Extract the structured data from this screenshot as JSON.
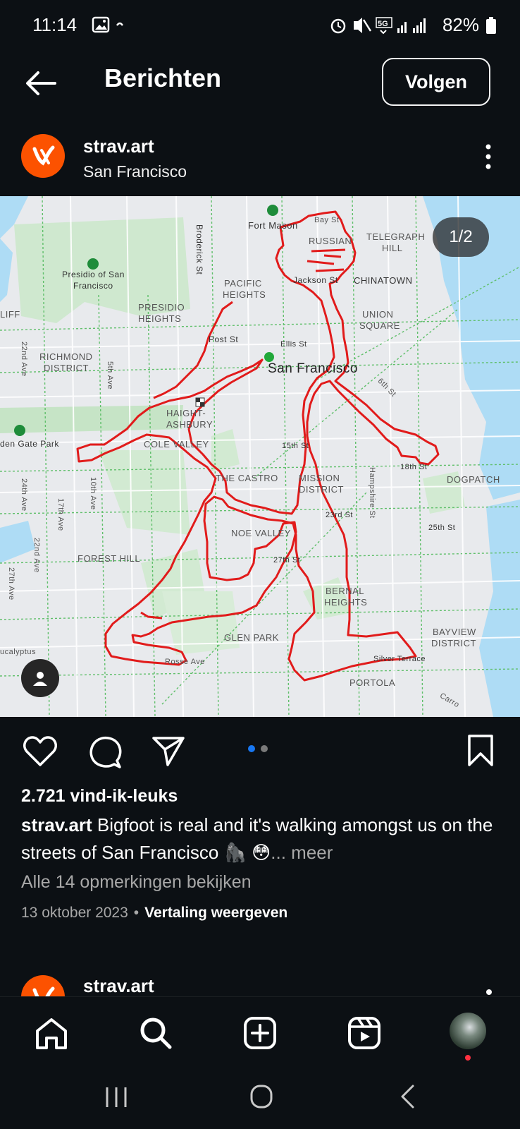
{
  "status": {
    "time": "11:14",
    "network": "5G",
    "battery": "82%"
  },
  "header": {
    "title": "Berichten",
    "follow_label": "Volgen"
  },
  "post": {
    "account": "strav.art",
    "location": "San Francisco",
    "counter": "1/2",
    "likes": "2.721 vind-ik-leuks",
    "caption_user": "strav.art",
    "caption_text": "Bigfoot is real and it's walking amongst us on the streets of San Francisco 🦍 😳",
    "caption_more": "... meer",
    "comments_link": "Alle 14 opmerkingen bekijken",
    "date": "13 oktober 2023",
    "separator": "•",
    "translate": "Vertaling weergeven"
  },
  "next_post": {
    "account": "strav.art"
  },
  "map": {
    "labels": {
      "fort_mason": "Fort Mason",
      "bay_st": "Bay St",
      "russian_hill": "RUSSIAN",
      "telegraph": "TELEGRAPH",
      "hill": "HILL",
      "chinatown": "CHINATOWN",
      "jackson_st": "Jackson St",
      "presidio": "Presidio of San",
      "francisco": "Francisco",
      "pacific": "PACIFIC",
      "heights": "HEIGHTS",
      "presidio_h": "PRESIDIO",
      "presidio_h2": "HEIGHTS",
      "broderick": "Broderick St",
      "union": "UNION",
      "square": "SQUARE",
      "post_st": "Post St",
      "ellis_st": "Ellis St",
      "san_francisco": "San Francisco",
      "richmond": "RICHMOND",
      "district": "DISTRICT",
      "ave22": "22nd Ave",
      "ave5": "5th Ave",
      "sixth": "6th St",
      "haight": "HAIGHT-",
      "ashbury": "ASHBURY",
      "cole": "COLE VALLEY",
      "golden": "den Gate Park",
      "fifteenth": "15th St",
      "eighteenth": "18th St",
      "dogpatch": "DOGPATCH",
      "castro": "THE CASTRO",
      "mission": "MISSION",
      "mdistrict": "DISTRICT",
      "hampshire": "Hampshire St",
      "ave24": "24th Ave",
      "ave10": "10th Ave",
      "ave17": "17th Ave",
      "twentythird": "23rd St",
      "twentyfifth": "25th St",
      "noe": "NOE VALLEY",
      "forest": "FOREST HILL",
      "twentyseventh": "27th St",
      "ave22b": "22nd Ave",
      "ave27": "27th Ave",
      "bernal": "BERNAL",
      "bheights": "HEIGHTS",
      "glen": "GLEN PARK",
      "bayview": "BAYVIEW",
      "bdistrict": "DISTRICT",
      "silver": "Silver Terrace",
      "portola": "PORTOLA",
      "rosse": "Rosse Ave",
      "eucalyptus": "ucalyptus",
      "carroll": "Carro",
      "cliff": "LIFF"
    }
  },
  "icons": {
    "back": "back-arrow-icon",
    "more": "more-vertical-icon",
    "heart": "heart-icon",
    "comment": "comment-icon",
    "share": "send-icon",
    "save": "bookmark-icon",
    "home": "home-icon",
    "search": "search-icon",
    "create": "create-icon",
    "reels": "reels-icon",
    "profile": "profile-avatar"
  },
  "colors": {
    "background": "#0c1014",
    "route": "#e11b1b",
    "accent": "#1877f2",
    "brand": "#fc5200"
  }
}
